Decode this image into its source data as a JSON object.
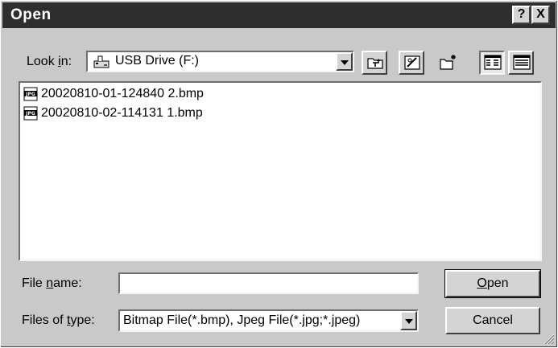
{
  "window": {
    "title": "Open",
    "help_glyph": "?",
    "close_glyph": "X"
  },
  "look_in": {
    "label_pre": "Look ",
    "label_mnemonic": "i",
    "label_post": "n:",
    "value": "USB Drive (F:)",
    "icon": "usb-drive-icon"
  },
  "toolbar": {
    "items": [
      "up-one-level-icon",
      "desktop-icon",
      "new-folder-icon",
      "list-view-icon",
      "details-view-icon"
    ]
  },
  "files": [
    {
      "name": "20020810-01-124840 2.bmp",
      "icon": "image-file-icon",
      "badge": "JPG"
    },
    {
      "name": "20020810-02-114131 1.bmp",
      "icon": "image-file-icon",
      "badge": "JPG"
    }
  ],
  "file_name": {
    "label_pre": "File ",
    "label_mnemonic": "n",
    "label_post": "ame:",
    "value": ""
  },
  "file_type": {
    "label_pre": "Files of ",
    "label_mnemonic": "t",
    "label_post": "ype:",
    "value": "Bitmap File(*.bmp), Jpeg File(*.jpg;*.jpeg)"
  },
  "buttons": {
    "open_mnemonic": "O",
    "open_rest": "pen",
    "cancel": "Cancel"
  },
  "colors": {
    "dialog_face": "#c9c9c9",
    "titlebar": "#2e2e2e",
    "list_background": "#ffffff"
  }
}
